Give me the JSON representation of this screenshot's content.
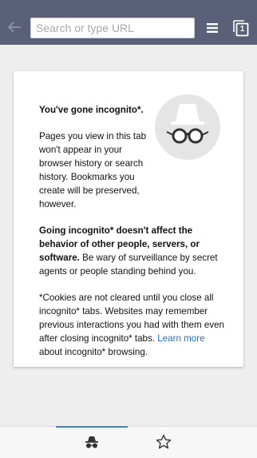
{
  "toolbar": {
    "back_icon": "back-arrow-icon",
    "url_placeholder": "Search or type URL",
    "url_value": "",
    "menu_icon": "menu-icon",
    "tab_count": "1",
    "background_color": "#5b6079"
  },
  "incognito_card": {
    "icon": "incognito-spy-icon",
    "heading": "You've gone incognito*.",
    "paragraph1": "Pages you view in this tab won't appear in your browser history or search history. Bookmarks you create will be preserved, however.",
    "paragraph2_bold": "Going incognito* doesn't affect the behavior of other people, servers, or software.",
    "paragraph2_rest": " Be wary of surveillance by secret agents or people standing behind you.",
    "paragraph3_start": "*Cookies are not cleared until you close all incognito* tabs. Websites may remember previous interactions you had with them even after closing incognito* tabs. ",
    "learn_more": "Learn more",
    "paragraph3_end": " about incognito* browsing.",
    "link_color": "#1e6fd9"
  },
  "bottom_bar": {
    "tabs": [
      {
        "icon": "incognito-icon",
        "selected": true
      },
      {
        "icon": "star-icon",
        "selected": false
      }
    ],
    "indicator_color": "#3b82d6"
  }
}
